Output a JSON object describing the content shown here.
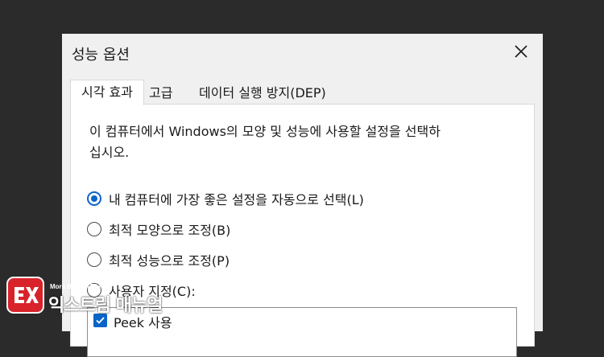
{
  "window": {
    "title": "성능 옵션"
  },
  "tabs": [
    {
      "label": "시각 효과",
      "active": true
    },
    {
      "label": "고급",
      "active": false
    },
    {
      "label": "데이터 실행 방지(DEP)",
      "active": false
    }
  ],
  "panel": {
    "description_line1": "이 컴퓨터에서 Windows의 모양 및 성능에 사용할 설정을 선택하",
    "description_line2": "십시오.",
    "options": [
      {
        "label": "내 컴퓨터에 가장 좋은 설정을 자동으로 선택(L)",
        "selected": true
      },
      {
        "label": "최적 모양으로 조정(B)",
        "selected": false
      },
      {
        "label": "최적 성능으로 조정(P)",
        "selected": false
      },
      {
        "label": "사용자 지정(C):",
        "selected": false
      }
    ],
    "list_items": [
      {
        "label": "Peek 사용",
        "checked": true
      }
    ]
  },
  "watermark": {
    "tagline": "More Better IT Life",
    "name": "익스트림 매뉴얼",
    "brand_color": "#d8232a"
  },
  "colors": {
    "accent": "#0a64c8",
    "background": "#2b2b2b",
    "dialog": "#f0f0f0"
  }
}
